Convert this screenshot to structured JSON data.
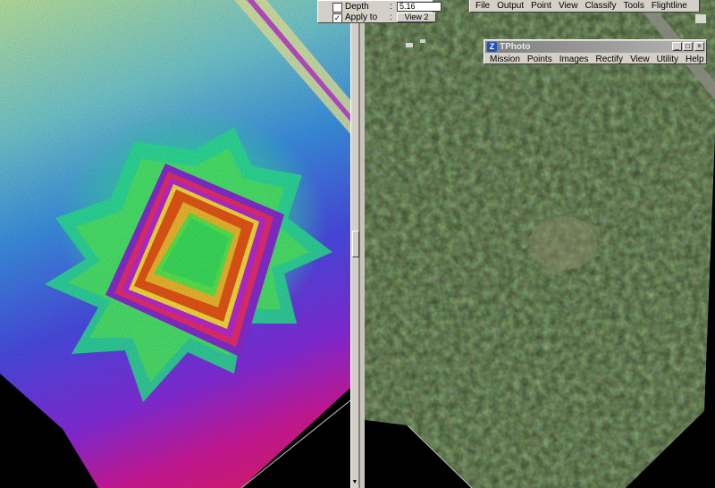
{
  "colors": {
    "dialog_face": "#d4d0c8",
    "titlebar_inactive_start": "#7f7f7f",
    "titlebar_inactive_end": "#b5b5b5"
  },
  "display_dialog": {
    "depth_label": "Depth",
    "depth_separator": ":",
    "depth_value": "5.16",
    "depth_checked": false,
    "apply_label": "Apply to",
    "apply_separator": ":",
    "apply_checked": true,
    "apply_button": "View 2"
  },
  "main_menu": [
    "File",
    "Output",
    "Point",
    "View",
    "Classify",
    "Tools",
    "Flightline"
  ],
  "tphoto": {
    "title": "TPhoto",
    "app_icon": "Z",
    "menu": [
      "Mission",
      "Points",
      "Images",
      "Rectify",
      "View",
      "Utility",
      "Help"
    ],
    "minimize": "_",
    "restore": "□",
    "close": "×"
  },
  "splitter": {
    "arrow": "▼"
  }
}
